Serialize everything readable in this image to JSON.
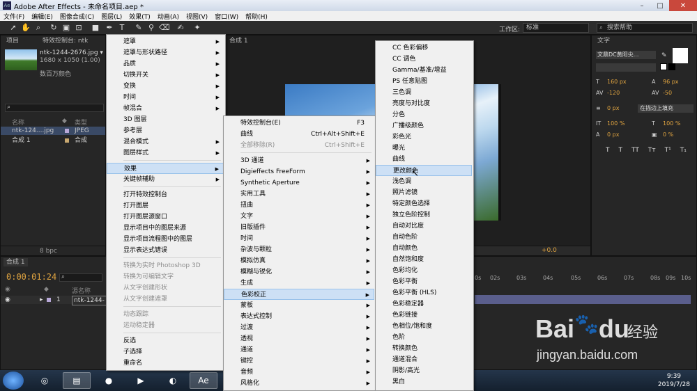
{
  "window": {
    "title": "Adobe After Effects - 未命名项目.aep *"
  },
  "menubar": [
    "文件(F)",
    "编辑(E)",
    "图像合成(C)",
    "图层(L)",
    "效果(T)",
    "动画(A)",
    "视图(V)",
    "窗口(W)",
    "帮助(H)"
  ],
  "toolbar": {
    "workspace_label": "工作区:",
    "workspace_value": "标准",
    "help_search": "搜索帮助"
  },
  "project_panel": {
    "tabs": [
      "项目",
      "特效控制台: ntk"
    ],
    "file_name": "ntk-1244-2676.jpg ▾",
    "file_size": "1680 x 1050 (1.00)",
    "file_colors": "数百万颜色",
    "col_name": "名称",
    "col_type": "类型",
    "items": [
      {
        "name": "ntk-124....jpg",
        "type": "JPEG"
      },
      {
        "name": "合成 1",
        "type": "合成"
      }
    ],
    "bpc": "8 bpc"
  },
  "comp_panel": {
    "tab": "合成 1",
    "exposure": "+0.0"
  },
  "text_panel": {
    "tab": "文字",
    "font": "文鼎DC黄阳尖...",
    "size": "160 px",
    "leading": "96 px",
    "kerning": "-120",
    "tracking": "-50",
    "stroke_width": "0 px",
    "stroke_mode": "在描边上填充",
    "vscale": "100 %",
    "hscale": "100 %",
    "baseline": "0 px",
    "tsume": "0 %",
    "format_buttons": [
      "T",
      "T",
      "TT",
      "Tт",
      "T¹",
      "T₁"
    ]
  },
  "timeline": {
    "tab": "合成 1",
    "timecode": "0:00:01:24",
    "col_source": "源名称",
    "layer_index": "1",
    "layer_name": "ntk-1244-",
    "ruler": [
      "0s",
      "02s",
      "03s",
      "04s",
      "05s",
      "06s",
      "07s",
      "08s",
      "09s",
      "10s"
    ]
  },
  "layer_menu": [
    {
      "label": "遮罩",
      "sub": true
    },
    {
      "label": "遮罩与形状路径",
      "sub": true
    },
    {
      "label": "品质",
      "sub": true
    },
    {
      "label": "切换开关",
      "sub": true
    },
    {
      "label": "变换",
      "sub": true
    },
    {
      "label": "时间",
      "sub": true
    },
    {
      "label": "帧混合",
      "sub": true
    },
    {
      "label": "3D 图层"
    },
    {
      "label": "参考层"
    },
    {
      "label": "混合模式",
      "sub": true
    },
    {
      "label": "图层样式",
      "sub": true
    },
    {
      "label": "效果",
      "sub": true,
      "hl": true
    },
    {
      "label": "关键帧辅助",
      "sub": true
    },
    {
      "label": "打开特效控制台"
    },
    {
      "label": "打开图层"
    },
    {
      "label": "打开图层源窗口"
    },
    {
      "label": "显示项目中的图层来源"
    },
    {
      "label": "显示项目流程图中的图层"
    },
    {
      "label": "显示表达式错误"
    },
    {
      "label": "转换为实时 Photoshop 3D",
      "disabled": true
    },
    {
      "label": "转换为可编辑文字",
      "disabled": true
    },
    {
      "label": "从文字创建形状",
      "disabled": true
    },
    {
      "label": "从文字创建遮罩",
      "disabled": true
    },
    {
      "label": "动态跟踪",
      "disabled": true
    },
    {
      "label": "运动稳定器",
      "disabled": true
    },
    {
      "label": "反选"
    },
    {
      "label": "子选择"
    },
    {
      "label": "重命名"
    }
  ],
  "effect_menu": [
    {
      "label": "特效控制台(E)",
      "shortcut": "F3"
    },
    {
      "label": "曲线",
      "shortcut": "Ctrl+Alt+Shift+E"
    },
    {
      "label": "全部移除(R)",
      "shortcut": "Ctrl+Shift+E",
      "disabled": true
    },
    {
      "label": "3D 通道",
      "sub": true
    },
    {
      "label": "Digieffects FreeForm",
      "sub": true
    },
    {
      "label": "Synthetic Aperture",
      "sub": true
    },
    {
      "label": "实用工具",
      "sub": true
    },
    {
      "label": "扭曲",
      "sub": true
    },
    {
      "label": "文字",
      "sub": true
    },
    {
      "label": "旧版插件",
      "sub": true
    },
    {
      "label": "时间",
      "sub": true
    },
    {
      "label": "杂波与颗粒",
      "sub": true
    },
    {
      "label": "模拟仿真",
      "sub": true
    },
    {
      "label": "模糊与锐化",
      "sub": true
    },
    {
      "label": "生成",
      "sub": true
    },
    {
      "label": "色彩校正",
      "sub": true,
      "hl": true
    },
    {
      "label": "蒙板",
      "sub": true
    },
    {
      "label": "表达式控制",
      "sub": true
    },
    {
      "label": "过渡",
      "sub": true
    },
    {
      "label": "透视",
      "sub": true
    },
    {
      "label": "通道",
      "sub": true
    },
    {
      "label": "键控",
      "sub": true
    },
    {
      "label": "音频",
      "sub": true
    },
    {
      "label": "风格化",
      "sub": true
    }
  ],
  "color_menu": [
    {
      "label": "CC 色彩偏移"
    },
    {
      "label": "CC 调色"
    },
    {
      "label": "Gamma/基准/增益"
    },
    {
      "label": "PS 任意贴图"
    },
    {
      "label": "三色调"
    },
    {
      "label": "亮度与对比度"
    },
    {
      "label": "分色"
    },
    {
      "label": "广播级颜色"
    },
    {
      "label": "彩色光"
    },
    {
      "label": "曝光"
    },
    {
      "label": "曲线"
    },
    {
      "label": "更改颜色",
      "hl": true
    },
    {
      "label": "浅色调"
    },
    {
      "label": "照片滤镜"
    },
    {
      "label": "特定颜色选择"
    },
    {
      "label": "独立色阶控制"
    },
    {
      "label": "自动对比度"
    },
    {
      "label": "自动色阶"
    },
    {
      "label": "自动颜色"
    },
    {
      "label": "自然饱和度"
    },
    {
      "label": "色彩均化"
    },
    {
      "label": "色彩平衡"
    },
    {
      "label": "色彩平衡 (HLS)"
    },
    {
      "label": "色彩稳定器"
    },
    {
      "label": "色彩链接"
    },
    {
      "label": "色相位/饱和度"
    },
    {
      "label": "色阶"
    },
    {
      "label": "转换颜色"
    },
    {
      "label": "通道混合"
    },
    {
      "label": "阴影/高光"
    },
    {
      "label": "黑白"
    }
  ],
  "taskbar": {
    "time": "9:39",
    "date": "2019/7/28"
  },
  "watermark": {
    "brand": "Bai",
    "brand2": "du",
    "cn": "经验",
    "url": "jingyan.baidu.com"
  }
}
